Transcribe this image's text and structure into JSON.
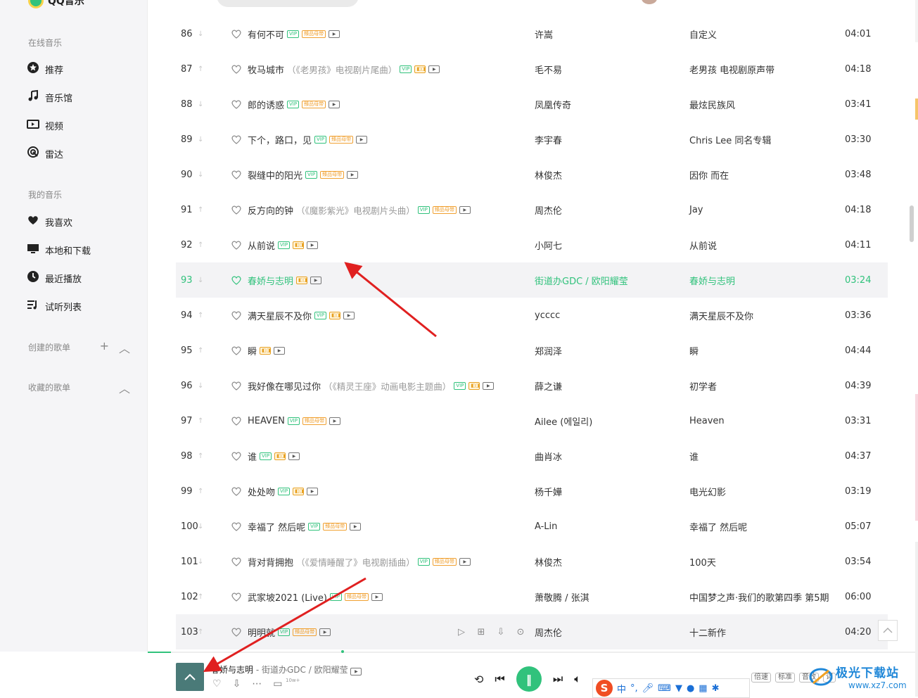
{
  "sidebar": {
    "logo_text": "QQ音乐",
    "online_label": "在线音乐",
    "online_items": [
      {
        "label": "推荐",
        "icon": "star-circle-icon"
      },
      {
        "label": "音乐馆",
        "icon": "music-note-icon"
      },
      {
        "label": "视频",
        "icon": "video-icon"
      },
      {
        "label": "雷达",
        "icon": "radar-icon"
      }
    ],
    "my_label": "我的音乐",
    "my_items": [
      {
        "label": "我喜欢",
        "icon": "heart-icon"
      },
      {
        "label": "本地和下载",
        "icon": "monitor-icon"
      },
      {
        "label": "最近播放",
        "icon": "clock-icon"
      },
      {
        "label": "试听列表",
        "icon": "playlist-icon"
      }
    ],
    "created_label": "创建的歌单",
    "collected_label": "收藏的歌单"
  },
  "songs": [
    {
      "num": "86",
      "trend": "↓",
      "title": "有何不可",
      "subtitle": "",
      "badges": [
        "VIP",
        "臻品母带",
        "MV"
      ],
      "artist": "许嵩",
      "album": "自定义",
      "duration": "04:01"
    },
    {
      "num": "87",
      "trend": "↑",
      "title": "牧马城市",
      "subtitle": "（《老男孩》电视剧片尾曲）",
      "badges": [
        "VIP",
        "DOLBY",
        "MV"
      ],
      "artist": "毛不易",
      "album": "老男孩 电视剧原声带",
      "duration": "04:18"
    },
    {
      "num": "88",
      "trend": "↓",
      "title": "郎的诱惑",
      "subtitle": "",
      "badges": [
        "VIP",
        "臻品母带",
        "MV"
      ],
      "artist": "凤凰传奇",
      "album": "最炫民族风",
      "duration": "03:41"
    },
    {
      "num": "89",
      "trend": "↓",
      "title": "下个，路口，见",
      "subtitle": "",
      "badges": [
        "VIP",
        "臻品母带",
        "MV"
      ],
      "artist": "李宇春",
      "album": "Chris Lee 同名专辑",
      "duration": "03:30"
    },
    {
      "num": "90",
      "trend": "↓",
      "title": "裂缝中的阳光",
      "subtitle": "",
      "badges": [
        "VIP",
        "臻品母带",
        "MV"
      ],
      "artist": "林俊杰",
      "album": "因你 而在",
      "duration": "03:48"
    },
    {
      "num": "91",
      "trend": "↑",
      "title": "反方向的钟",
      "subtitle": "（《魔影紫光》电视剧片头曲）",
      "badges": [
        "VIP",
        "臻品母带",
        "MV"
      ],
      "artist": "周杰伦",
      "album": "Jay",
      "duration": "04:18"
    },
    {
      "num": "92",
      "trend": "↑",
      "title": "从前说",
      "subtitle": "",
      "badges": [
        "VIP",
        "DOLBY",
        "MV"
      ],
      "artist": "小阿七",
      "album": "从前说",
      "duration": "04:11"
    },
    {
      "num": "93",
      "trend": "↓",
      "title": "春娇与志明",
      "subtitle": "",
      "badges": [
        "DOLBY",
        "MV"
      ],
      "artist": "街道办GDC / 欧阳耀莹",
      "album": "春娇与志明",
      "duration": "03:24",
      "active": true
    },
    {
      "num": "94",
      "trend": "↑",
      "title": "满天星辰不及你",
      "subtitle": "",
      "badges": [
        "VIP",
        "DOLBY",
        "MV"
      ],
      "artist": "ycccc",
      "album": "满天星辰不及你",
      "duration": "03:36"
    },
    {
      "num": "95",
      "trend": "↑",
      "title": "瞬",
      "subtitle": "",
      "badges": [
        "DOLBY",
        "MV"
      ],
      "artist": "郑润泽",
      "album": "瞬",
      "duration": "04:44"
    },
    {
      "num": "96",
      "trend": "↓",
      "title": "我好像在哪见过你",
      "subtitle": "（《精灵王座》动画电影主题曲）",
      "badges": [
        "VIP",
        "DOLBY",
        "MV"
      ],
      "artist": "薛之谦",
      "album": "初学者",
      "duration": "04:39"
    },
    {
      "num": "97",
      "trend": "↑",
      "title": "HEAVEN",
      "subtitle": "",
      "badges": [
        "VIP",
        "臻品母带",
        "MV"
      ],
      "artist": "Ailee (에일리)",
      "album": "Heaven",
      "duration": "03:31"
    },
    {
      "num": "98",
      "trend": "↑",
      "title": "谁",
      "subtitle": "",
      "badges": [
        "VIP",
        "DOLBY",
        "MV"
      ],
      "artist": "曲肖冰",
      "album": "谁",
      "duration": "04:37"
    },
    {
      "num": "99",
      "trend": "↑",
      "title": "处处吻",
      "subtitle": "",
      "badges": [
        "VIP",
        "DOLBY",
        "MV"
      ],
      "artist": "杨千嬅",
      "album": "电光幻影",
      "duration": "03:19"
    },
    {
      "num": "100",
      "trend": "↓",
      "title": "幸福了 然后呢",
      "subtitle": "",
      "badges": [
        "VIP",
        "臻品母带",
        "MV"
      ],
      "artist": "A-Lin",
      "album": "幸福了 然后呢",
      "duration": "05:07"
    },
    {
      "num": "101",
      "trend": "↓",
      "title": "背对背拥抱",
      "subtitle": "（《爱情睡醒了》电视剧插曲）",
      "badges": [
        "VIP",
        "臻品母带",
        "MV"
      ],
      "artist": "林俊杰",
      "album": "100天",
      "duration": "03:54"
    },
    {
      "num": "102",
      "trend": "↑",
      "title": "武家坡2021 (Live)",
      "subtitle": "",
      "badges": [
        "VIP",
        "臻品母带",
        "MV"
      ],
      "artist": "萧敬腾 / 张淇",
      "album": "中国梦之声·我们的歌第四季 第5期",
      "duration": "06:00"
    },
    {
      "num": "103",
      "trend": "↑",
      "title": "明明就",
      "subtitle": "",
      "badges": [
        "VIP",
        "臻品母带",
        "MV"
      ],
      "artist": "周杰伦",
      "album": "十二新作",
      "duration": "04:20",
      "hover": true
    }
  ],
  "row_actions": [
    "play-icon",
    "add-icon",
    "download-icon",
    "more-icon"
  ],
  "player": {
    "now_playing_title": "春娇与志明",
    "now_playing_artist": "街道办GDC / 欧阳耀莹",
    "comment_count": "10w+",
    "progress": 0.03,
    "speed_label": "倍速",
    "quality_label": "标准",
    "effect_label": "音效",
    "lyrics_label": "词"
  },
  "ime": {
    "brand": "S",
    "lang": "中"
  },
  "watermark": {
    "name": "极光下载站",
    "url": "www.xz7.com"
  },
  "colors": {
    "accent": "#31c27c",
    "arrow": "#e02020",
    "watermark": "#1f87d8"
  }
}
